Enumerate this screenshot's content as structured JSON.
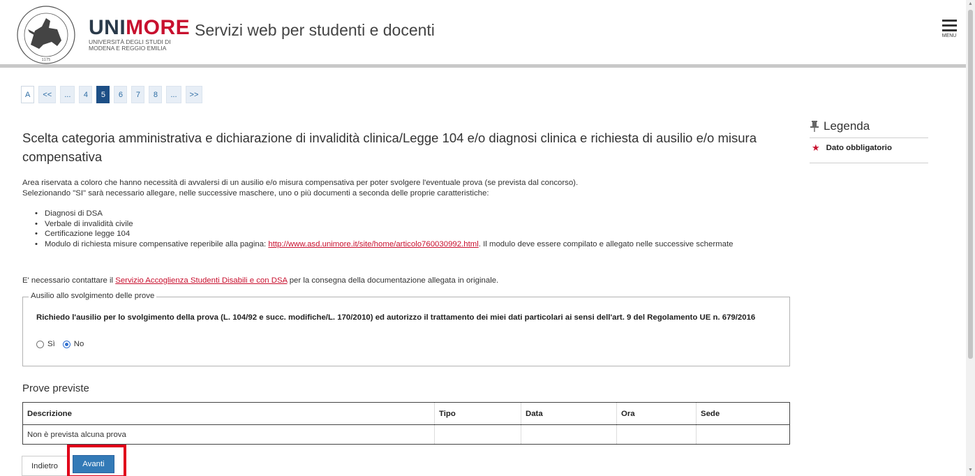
{
  "header": {
    "brand_prefix": "UNI",
    "brand_highlight": "MORE",
    "brand_sub_line1": "UNIVERSITÀ DEGLI STUDI DI",
    "brand_sub_line2": "MODENA E REGGIO EMILIA",
    "seal_year": "1175",
    "site_title": "Servizi web per studenti e docenti",
    "menu_label": "MENU"
  },
  "pager": {
    "items": [
      "A",
      "<<",
      "...",
      "4",
      "5",
      "6",
      "7",
      "8",
      "...",
      ">>"
    ],
    "current": "5"
  },
  "content": {
    "title": "Scelta categoria amministrativa e dichiarazione di invalidità clinica/Legge 104 e/o diagnosi clinica e richiesta di ausilio e/o misura compensativa",
    "intro_line1": "Area riservata a coloro che hanno necessità di avvalersi di un ausilio e/o misura compensativa per poter svolgere l'eventuale prova (se prevista dal concorso).",
    "intro_line2": "Selezionando \"SI\" sarà necessario allegare, nelle successive maschere, uno o più documenti a seconda delle proprie caratteristiche:",
    "bullets": {
      "b1": "Diagnosi di DSA",
      "b2": "Verbale di invalidità civile",
      "b3": "Certificazione legge 104",
      "b4_pre": "Modulo di richiesta misure compensative reperibile alla pagina: ",
      "b4_link": "http://www.asd.unimore.it/site/home/articolo760030992.html",
      "b4_post": ". Il modulo deve essere compilato e allegato nelle successive schermate"
    },
    "contact_pre": "E' necessario contattare il ",
    "contact_link": "Servizio Accoglienza Studenti Disabili e con DSA",
    "contact_post": " per la consegna della documentazione allegata in originale."
  },
  "fieldset": {
    "legend": "Ausilio allo svolgimento delle prove",
    "question": "Richiedo l'ausilio per lo svolgimento della prova (L. 104/92 e succ. modifiche/L. 170/2010) ed autorizzo il trattamento dei miei dati particolari ai sensi dell'art. 9 del Regolamento UE n. 679/2016",
    "option_yes": "Sì",
    "option_no": "No",
    "selected": "No"
  },
  "prove": {
    "title": "Prove previste",
    "headers": [
      "Descrizione",
      "Tipo",
      "Data",
      "Ora",
      "Sede"
    ],
    "empty_row": "Non è prevista alcuna prova"
  },
  "buttons": {
    "back": "Indietro",
    "next": "Avanti"
  },
  "legenda": {
    "title": "Legenda",
    "required_label": "Dato obbligatorio"
  },
  "colors": {
    "brand_red": "#c8102e",
    "primary_blue": "#337ab7",
    "pager_current": "#1d4f86",
    "highlight_red": "#e0001a"
  }
}
